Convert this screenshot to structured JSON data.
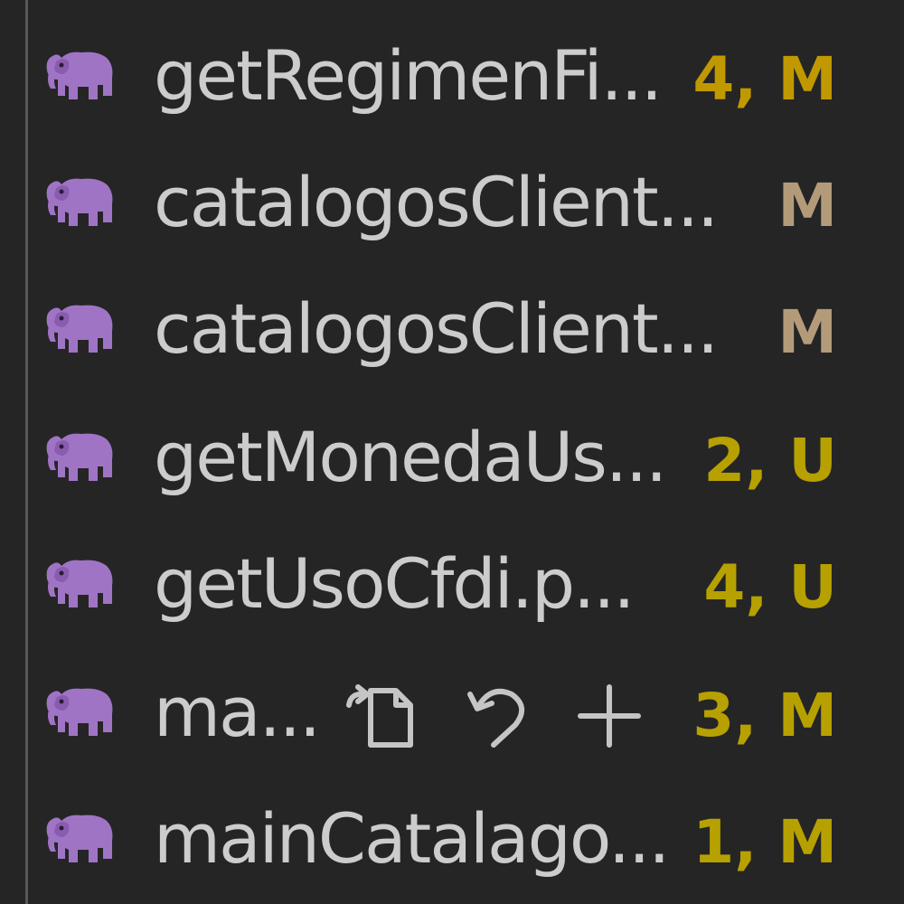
{
  "explorer": {
    "files": [
      {
        "name": "getRegimenFi...",
        "badge": "4, M",
        "badge_color": "#c09900",
        "icon": "php-elephant-icon"
      },
      {
        "name": "catalogosClient...",
        "badge": "M",
        "badge_color": "#b39b7a",
        "icon": "php-elephant-icon"
      },
      {
        "name": "catalogosClient...",
        "badge": "M",
        "badge_color": "#b39b7a",
        "icon": "php-elephant-icon"
      },
      {
        "name": "getMonedaUs...",
        "badge": "2, U",
        "badge_color": "#b7a100",
        "icon": "php-elephant-icon"
      },
      {
        "name": "getUsoCfdi.p...",
        "badge": "4, U",
        "badge_color": "#b7a100",
        "icon": "php-elephant-icon"
      },
      {
        "name": "ma...",
        "badge": "3, M",
        "badge_color": "#b7a100",
        "icon": "php-elephant-icon",
        "actions": [
          "open-file-icon",
          "discard-changes-icon",
          "stage-changes-icon"
        ]
      },
      {
        "name": "mainCatalago...",
        "badge": "1, M",
        "badge_color": "#b7a100",
        "icon": "php-elephant-icon"
      }
    ]
  },
  "colors": {
    "background": "#252526",
    "text": "#cccccc",
    "icon": "#a074c4",
    "indent_guide": "#585858"
  }
}
